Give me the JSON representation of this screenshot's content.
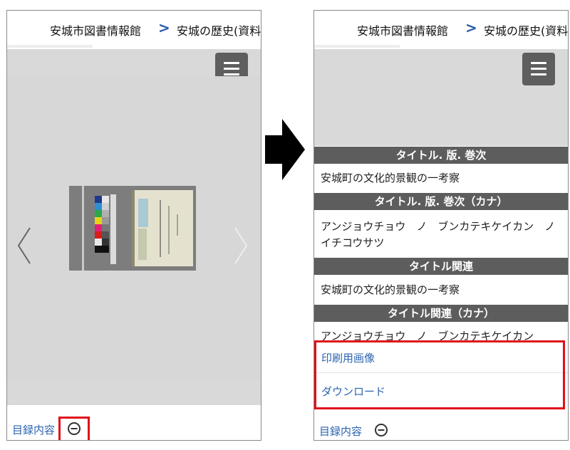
{
  "breadcrumb": {
    "library": "安城市図書情報館",
    "separator": ">",
    "collection": "安城の歴史(資料"
  },
  "metadata": [
    {
      "heading": "タイトル. 版. 巻次",
      "value": "安城町の文化的景観の一考察"
    },
    {
      "heading": "タイトル. 版. 巻次（カナ）",
      "value": "アンジョウチョウ　ノ　ブンカテキケイカン　ノ　イチコウサツ"
    },
    {
      "heading": "タイトル関連",
      "value": "安城町の文化的景観の一考察"
    },
    {
      "heading": "タイトル関連（カナ）",
      "value": "アンジョウチョウ　ノ　ブンカテキケイカン"
    }
  ],
  "links": {
    "print_image": "印刷用画像",
    "download": "ダウンロード",
    "catalog_contents": "目録内容"
  },
  "icons": {
    "menu": "hamburger-menu-icon",
    "toggle": "minus-circle-icon",
    "prev": "chevron-left-icon",
    "next": "chevron-right-icon",
    "transition": "arrow-right-icon"
  },
  "colors": {
    "highlight": "#e0101a",
    "link": "#2a64b0",
    "section_header": "#5d5d5d",
    "breadcrumb_separator": "#2a5aa8"
  }
}
